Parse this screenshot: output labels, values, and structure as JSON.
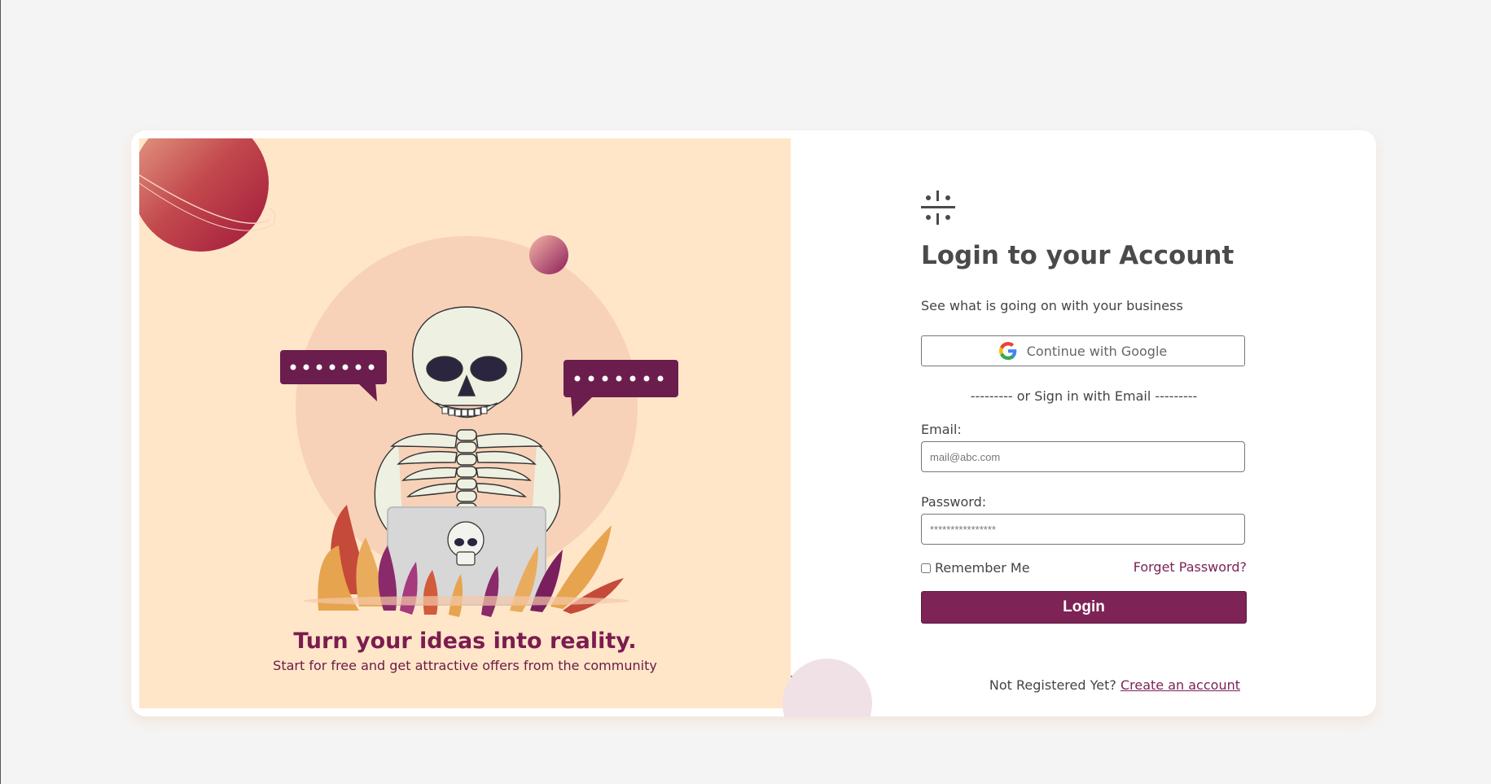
{
  "hero": {
    "title": "Turn your ideas into reality.",
    "subtitle": "Start for free and get attractive offers from the community",
    "illustration": "skeleton-with-laptop-illustration"
  },
  "form": {
    "title": "Login to your Account",
    "subtitle": "See what is going on with your business",
    "google_label": "Continue with Google",
    "divider": "--------- or Sign in with Email ---------",
    "email_label": "Email:",
    "email_placeholder": "mail@abc.com",
    "password_label": "Password:",
    "password_placeholder": "****************",
    "remember_label": "Remember Me",
    "remember_checked": false,
    "forget_label": "Forget Password?",
    "login_label": "Login",
    "register_prompt": "Not Registered Yet?",
    "register_link": "Create an account"
  },
  "colors": {
    "accent": "#7e2356",
    "hero_background": "#ffe6c9",
    "page_background": "#f4f4f4",
    "title_text": "#4a4a4a"
  },
  "icons": {
    "logo": "brand-logo-icon",
    "google": "google-icon"
  }
}
